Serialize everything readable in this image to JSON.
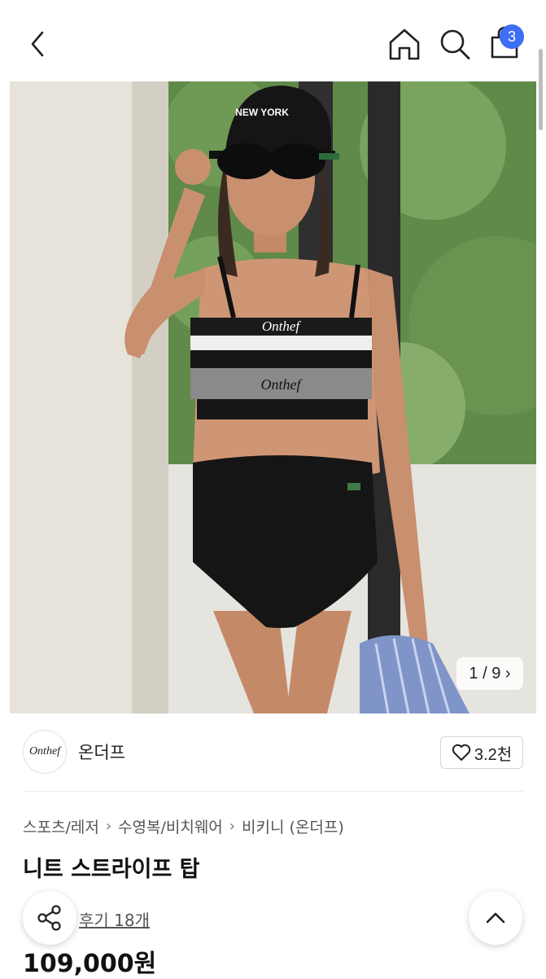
{
  "header": {
    "cart_badge": "3"
  },
  "hero": {
    "counter": "1 / 9 ›",
    "brand_print": "Onthef",
    "cap_print": "NEW YORK"
  },
  "brand": {
    "logo_text": "Onthef",
    "name": "온더프",
    "likes": "3.2천"
  },
  "breadcrumb": [
    "스포츠/레저",
    "수영복/비치웨어",
    "비키니 (온더프)"
  ],
  "product": {
    "title": "니트 스트라이프 탑",
    "reviews": "후기 18개",
    "price": "109,000원"
  }
}
